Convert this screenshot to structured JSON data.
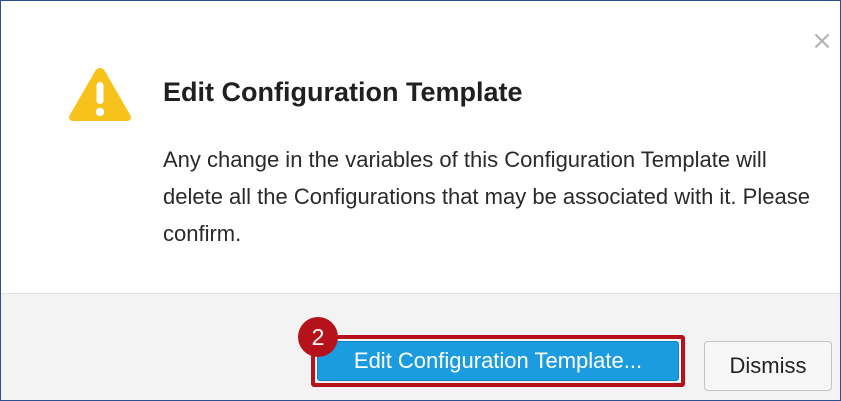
{
  "dialog": {
    "title": "Edit Configuration Template",
    "message": "Any change in the variables of this Configuration Template will delete all the Configurations that may be associated with it. Please confirm.",
    "close_glyph": "×",
    "warning_icon": "warning-triangle-icon"
  },
  "footer": {
    "confirm_label": "Edit Configuration Template...",
    "dismiss_label": "Dismiss"
  },
  "annotation": {
    "step_number": "2"
  },
  "colors": {
    "primary_button": "#1b9ce0",
    "highlight": "#b5121b",
    "warning": "#f7c21b",
    "dialog_border": "#2c4f8f"
  }
}
